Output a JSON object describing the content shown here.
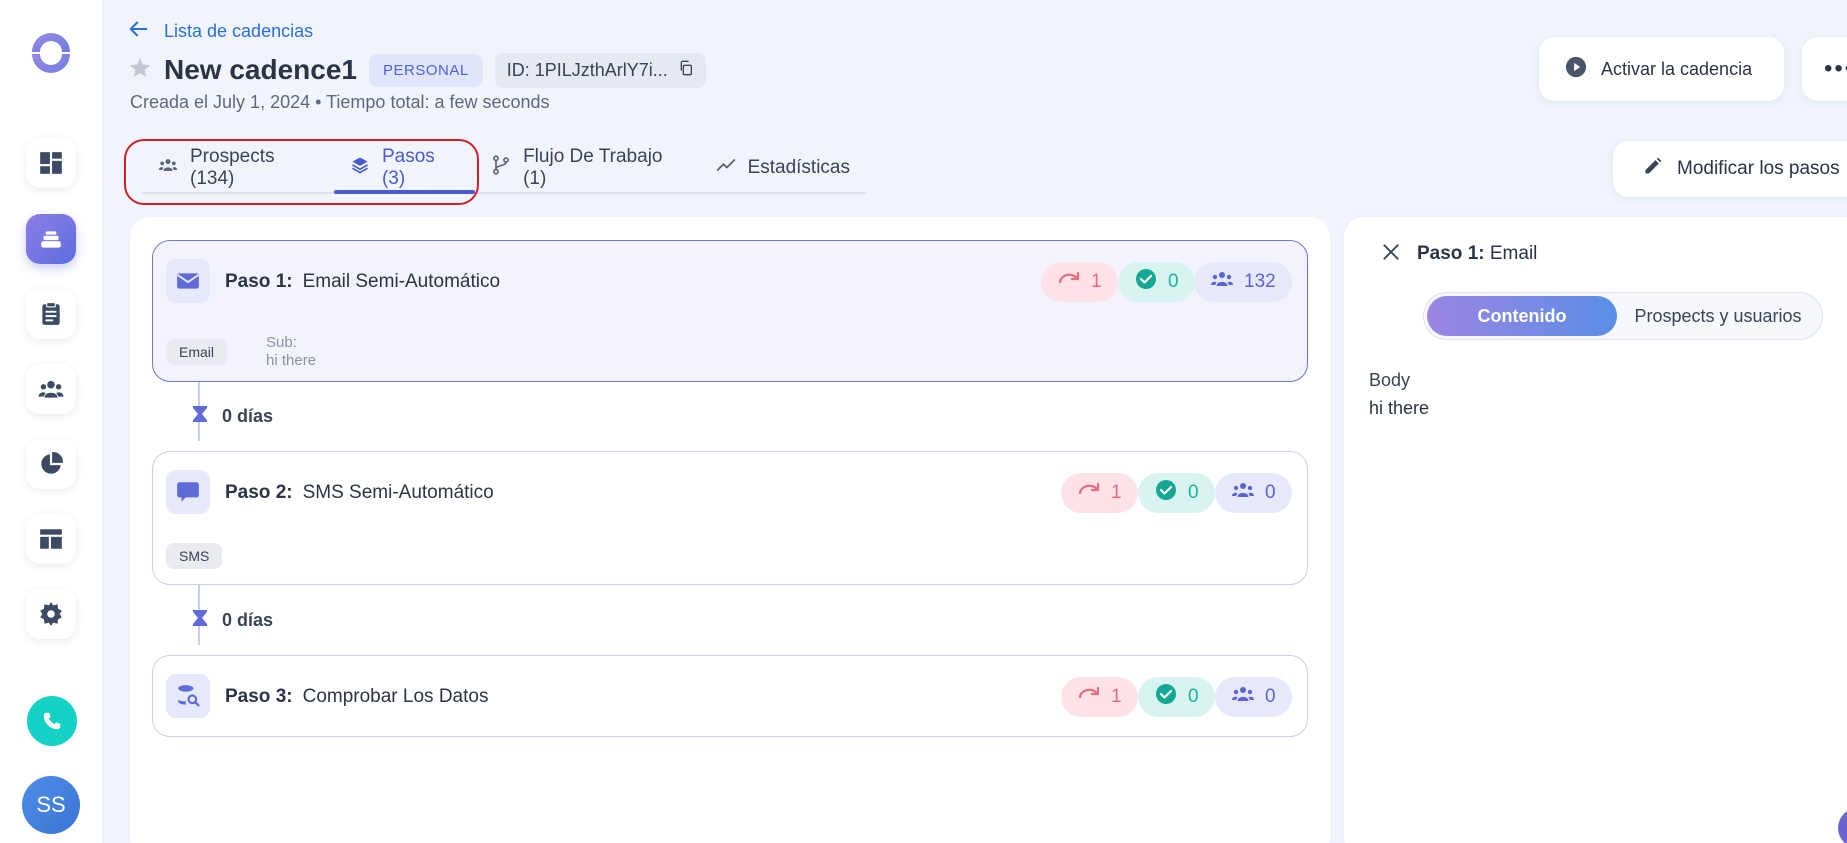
{
  "header": {
    "back_label": "Lista de cadencias",
    "title": "New cadence1",
    "badge": "PERSONAL",
    "id_text": "ID: 1PILJzthArlY7i...",
    "subtitle": "Creada el July 1, 2024 • Tiempo total: a few seconds",
    "activate_label": "Activar la cadencia",
    "more_label": "•••",
    "modify_label": "Modificar los pasos"
  },
  "tabs": [
    {
      "label": "Prospects (134)",
      "icon": "users-icon",
      "active": false
    },
    {
      "label": "Pasos (3)",
      "icon": "layers-icon",
      "active": true
    },
    {
      "label": "Flujo De Trabajo (1)",
      "icon": "workflow-icon",
      "active": false
    },
    {
      "label": "Estadísticas",
      "icon": "trend-icon",
      "active": false
    }
  ],
  "steps": [
    {
      "prefix": "Paso 1:",
      "name": "Email Semi-Automático",
      "icon": "mail-icon",
      "chip": "Email",
      "sub_label": "Sub:",
      "sub_value": "hi there",
      "skipped": "1",
      "done": "0",
      "prospects": "132"
    },
    {
      "prefix": "Paso 2:",
      "name": "SMS Semi-Automático",
      "icon": "chat-icon",
      "chip": "SMS",
      "skipped": "1",
      "done": "0",
      "prospects": "0"
    },
    {
      "prefix": "Paso 3:",
      "name": "Comprobar Los Datos",
      "icon": "database-search-icon",
      "skipped": "1",
      "done": "0",
      "prospects": "0"
    }
  ],
  "delays": [
    "0 días",
    "0 días"
  ],
  "detail": {
    "title_prefix": "Paso 1:",
    "title_name": "Email",
    "seg_active": "Contenido",
    "seg_inactive": "Prospects y usuarios",
    "body_label": "Body",
    "body_value": "hi there"
  },
  "user": {
    "initials": "SS"
  },
  "colors": {
    "accent": "#4a5ad0",
    "link": "#2a6fd6",
    "highlight_border": "#d21e2b",
    "phone": "#14d1c6"
  }
}
